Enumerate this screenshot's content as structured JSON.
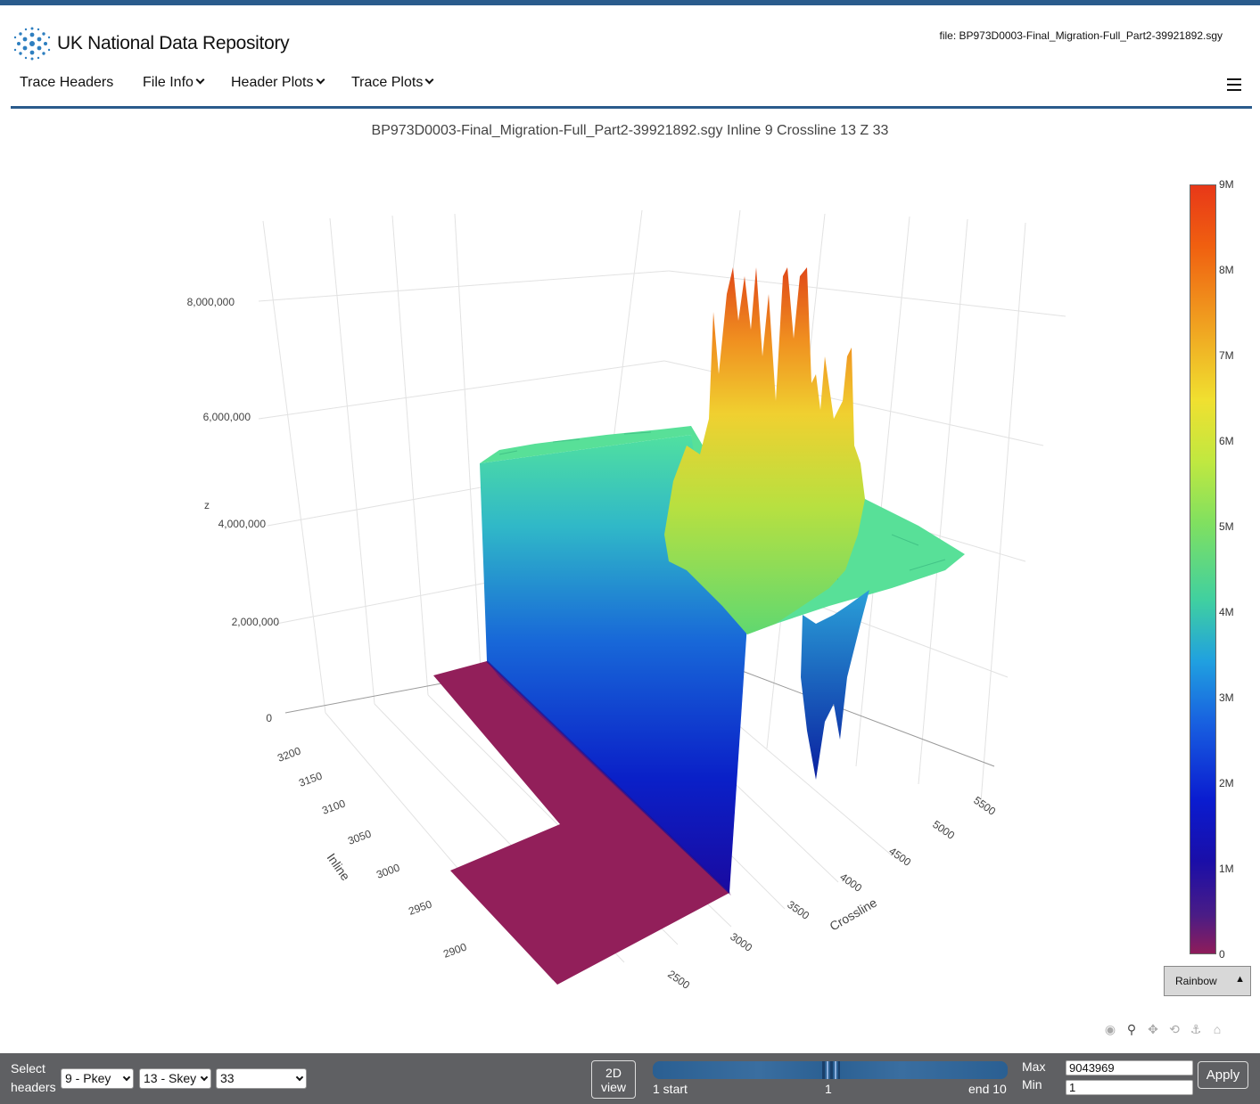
{
  "app": {
    "title": "UK National Data Repository",
    "file_label": "file: BP973D0003-Final_Migration-Full_Part2-39921892.sgy"
  },
  "nav": {
    "items": [
      {
        "label": "Trace Headers",
        "has_dropdown": false
      },
      {
        "label": "File Info",
        "has_dropdown": true
      },
      {
        "label": "Header Plots",
        "has_dropdown": true
      },
      {
        "label": "Trace Plots",
        "has_dropdown": true
      }
    ],
    "menu_icon": "hamburger-icon"
  },
  "plot": {
    "title": "BP973D0003-Final_Migration-Full_Part2-39921892.sgy Inline 9 Crossline 13 Z 33"
  },
  "chart_data": {
    "type": "surface",
    "xlabel": "Crossline",
    "ylabel": "Inline",
    "zlabel": "z",
    "x_ticks": [
      "2500",
      "3000",
      "3500",
      "4000",
      "4500",
      "5000",
      "5500"
    ],
    "y_ticks": [
      "2900",
      "2950",
      "3000",
      "3050",
      "3100",
      "3150",
      "3200"
    ],
    "z_ticks": [
      "0",
      "2,000,000",
      "4,000,000",
      "6,000,000",
      "8,000,000"
    ],
    "plateau_z": 4500000,
    "zlim": [
      0,
      9000000
    ],
    "colorscale": "Rainbow",
    "colorbar_ticks": [
      "0",
      "1M",
      "2M",
      "3M",
      "4M",
      "5M",
      "6M",
      "7M",
      "8M",
      "9M"
    ],
    "colors": {
      "low": "#8e1c5a",
      "mid": "#40d0a0",
      "high": "#e83818"
    }
  },
  "colorscale_button": {
    "label": "Rainbow",
    "arrow": "▲"
  },
  "modebar": [
    {
      "name": "camera-icon",
      "glyph": "📷"
    },
    {
      "name": "zoom-icon",
      "glyph": "🔍"
    },
    {
      "name": "pan-icon",
      "glyph": "✥"
    },
    {
      "name": "orbit-icon",
      "glyph": "⟲"
    },
    {
      "name": "turntable-icon",
      "glyph": "⚓"
    },
    {
      "name": "home-icon",
      "glyph": "⌂"
    }
  ],
  "footer": {
    "select_label_1": "Select",
    "select_label_2": "headers",
    "pkey": "9 - Pkey",
    "skey": "13 - Skey",
    "zval": "33",
    "view_btn_1": "2D",
    "view_btn_2": "view",
    "slider_start": "1 start",
    "slider_mid": "1",
    "slider_end": "end 10",
    "max_label": "Max",
    "min_label": "Min",
    "max_value": "9043969",
    "min_value": "1",
    "apply_label": "Apply"
  }
}
